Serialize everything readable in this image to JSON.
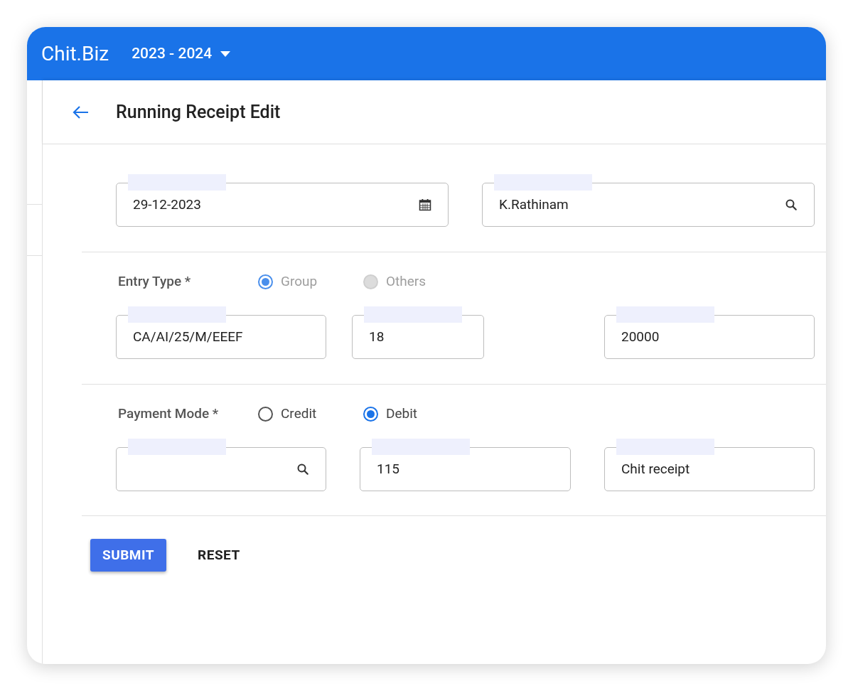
{
  "app_bar": {
    "brand": "Chit.Biz",
    "year_selector": "2023 - 2024"
  },
  "page": {
    "title": "Running Receipt Edit"
  },
  "rows": [
    {
      "kind": "fields",
      "fields": [
        {
          "kind": "date",
          "value": "29-12-2023"
        },
        {
          "kind": "search",
          "value": "K.Rathinam"
        }
      ]
    },
    {
      "kind": "radio",
      "label": "Entry Type *",
      "options": [
        {
          "label": "Group",
          "selected": true,
          "disabled": true
        },
        {
          "label": "Others",
          "selected": false,
          "disabled": true
        }
      ]
    },
    {
      "kind": "fields",
      "fields": [
        {
          "kind": "text",
          "value": "CA/AI/25/M/EEEF"
        },
        {
          "kind": "text",
          "value": "18"
        },
        {
          "kind": "text",
          "value": "20000"
        }
      ]
    },
    {
      "kind": "radio",
      "label": "Payment Mode *",
      "options": [
        {
          "label": "Credit",
          "selected": false,
          "disabled": false
        },
        {
          "label": "Debit",
          "selected": true,
          "disabled": false
        }
      ]
    },
    {
      "kind": "fields",
      "fields": [
        {
          "kind": "search"
        },
        {
          "kind": "text",
          "value": "115"
        },
        {
          "kind": "text",
          "value": "Chit receipt"
        }
      ]
    }
  ],
  "buttons": [
    {
      "kind": "primary",
      "label": "SUBMIT"
    },
    {
      "kind": "text",
      "label": "RESET"
    }
  ]
}
